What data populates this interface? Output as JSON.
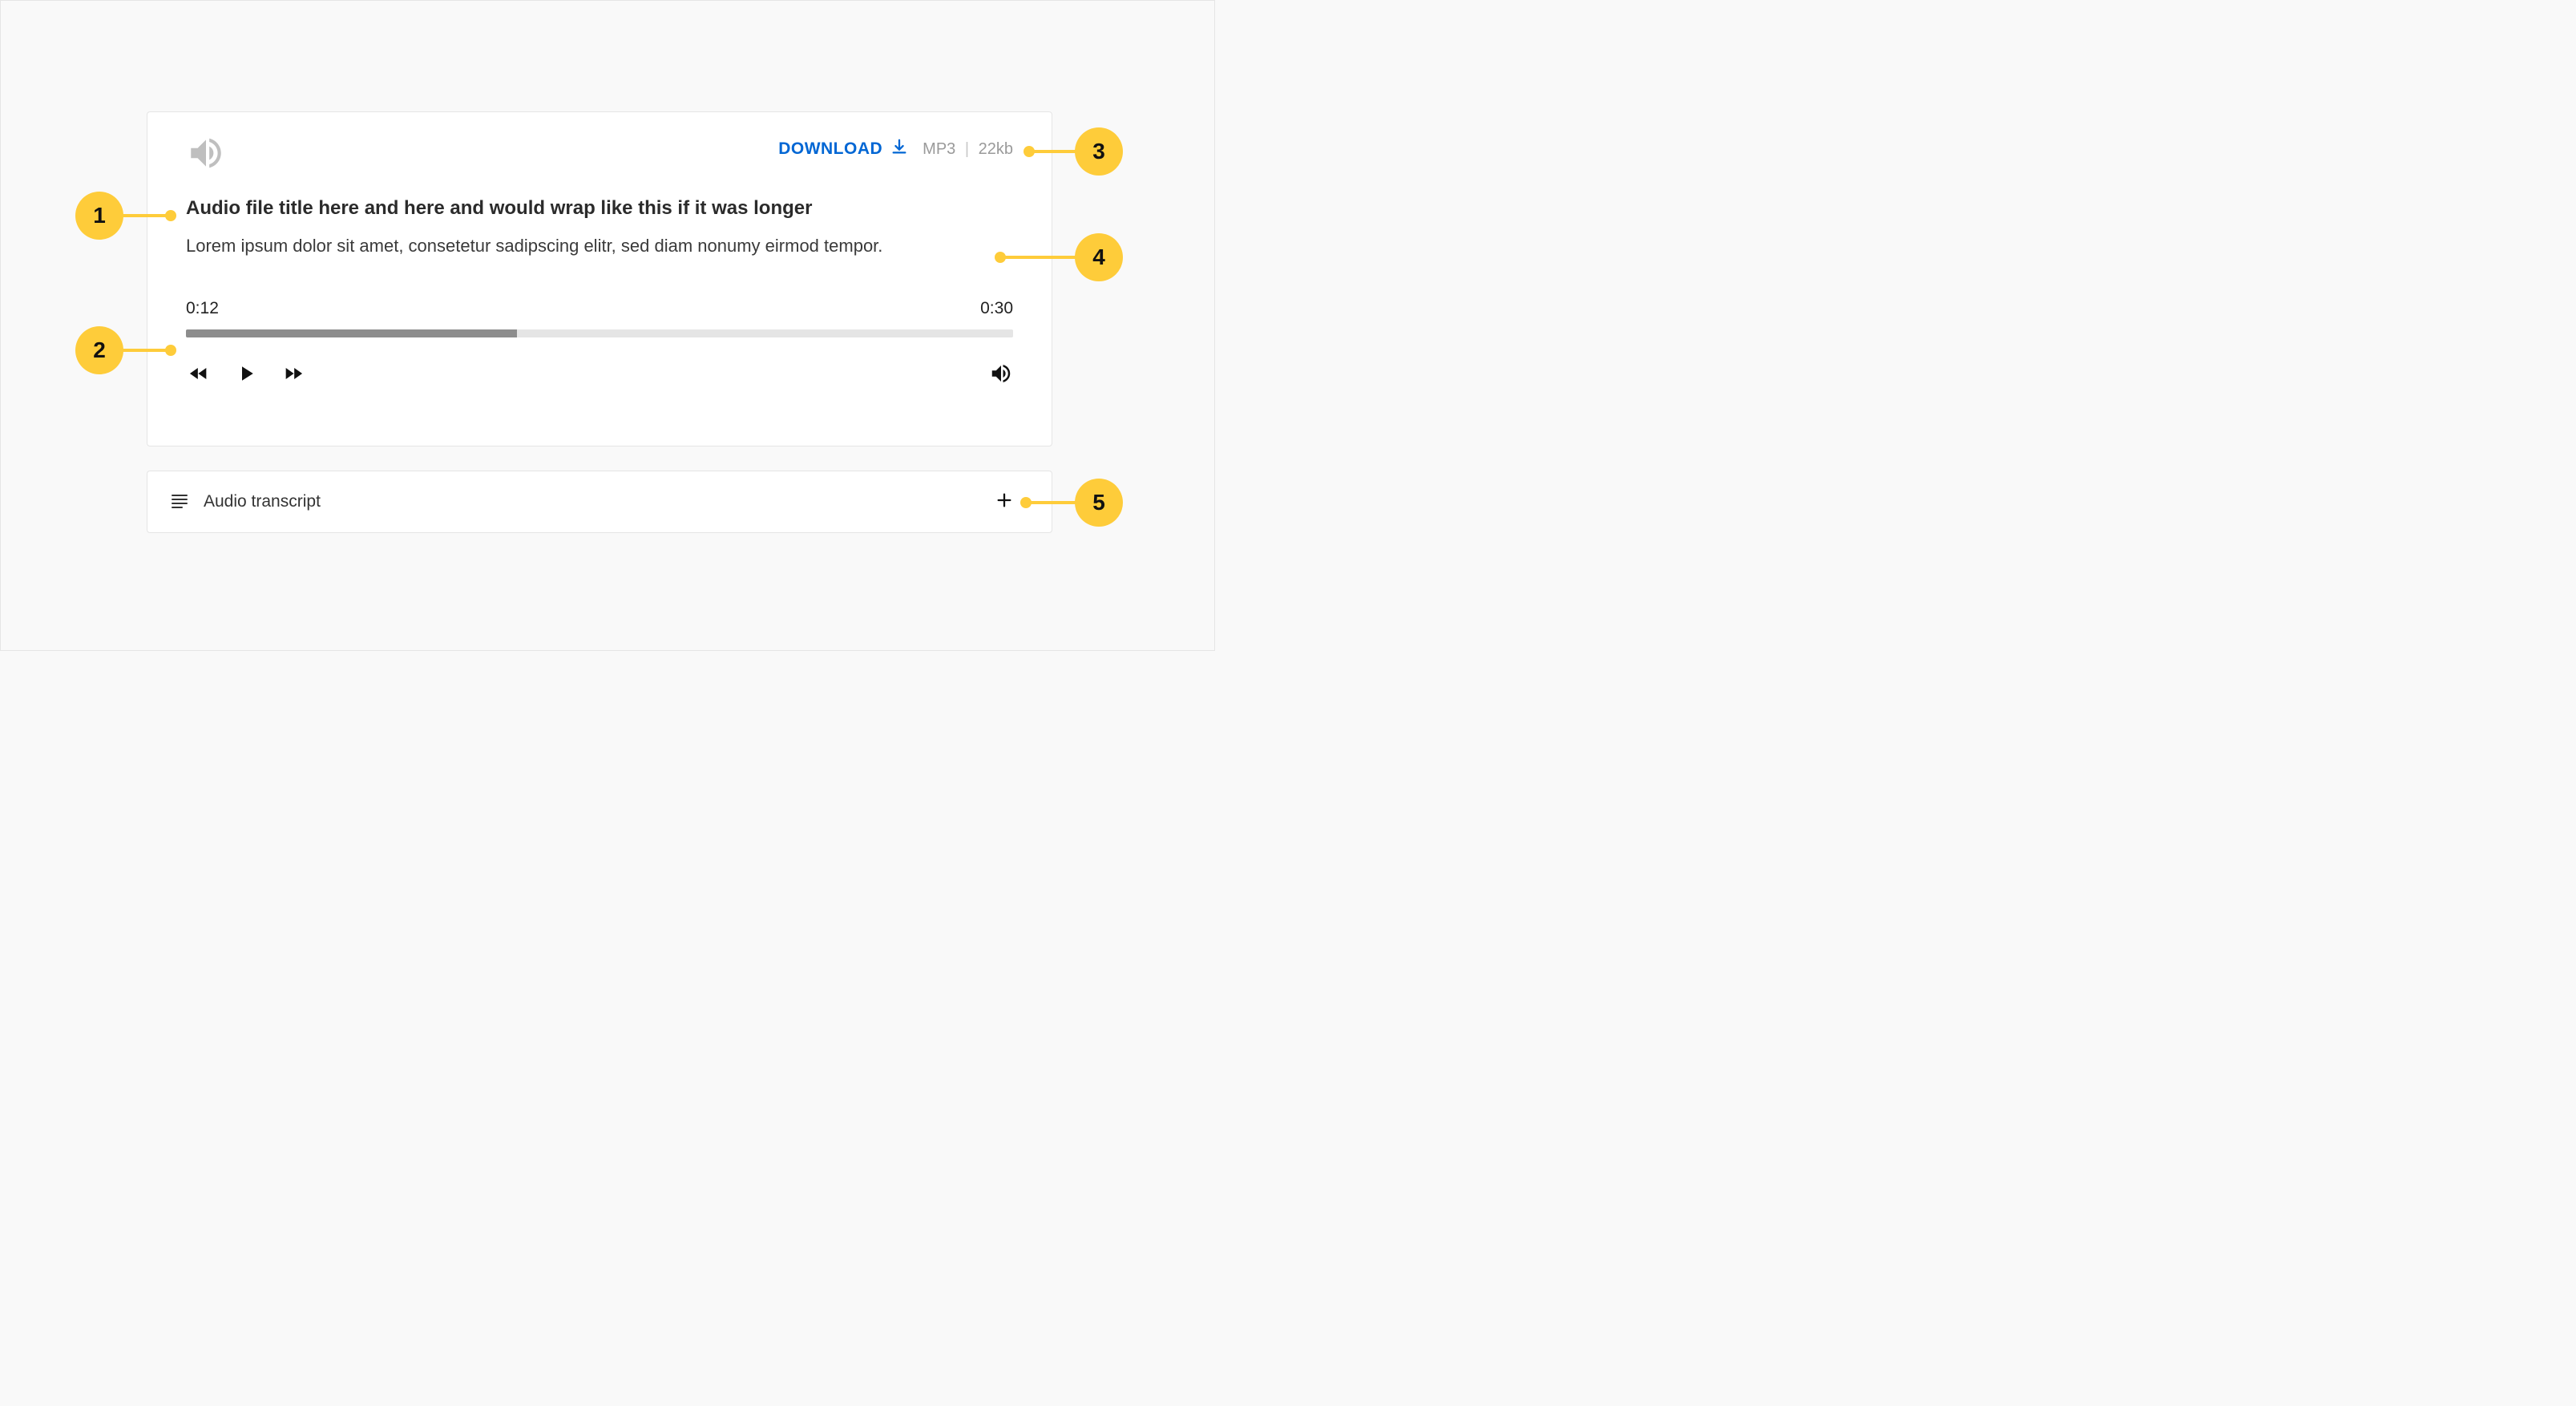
{
  "player": {
    "download_label": "DOWNLOAD",
    "file_format": "MP3",
    "file_size": "22kb",
    "title": "Audio file title here and here and would wrap like this if it was longer",
    "description": "Lorem ipsum dolor sit amet, consetetur sadipscing elitr, sed diam nonumy eirmod tempor.",
    "elapsed_time": "0:12",
    "total_time": "0:30",
    "progress_percent": 40
  },
  "transcript": {
    "label": "Audio transcript"
  },
  "callouts": {
    "c1": "1",
    "c2": "2",
    "c3": "3",
    "c4": "4",
    "c5": "5"
  }
}
